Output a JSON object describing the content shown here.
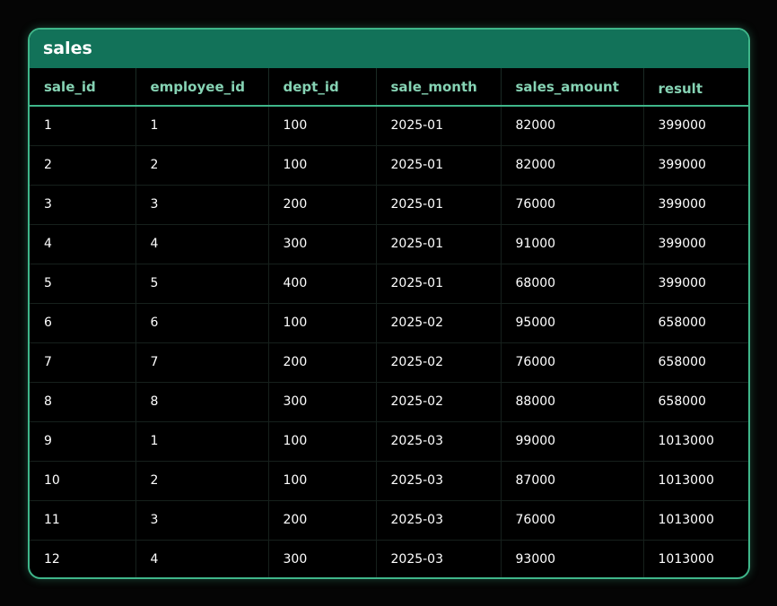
{
  "table": {
    "title": "sales",
    "columns": [
      "sale_id",
      "employee_id",
      "dept_id",
      "sale_month",
      "sales_amount",
      "result"
    ],
    "rows": [
      [
        "1",
        "1",
        "100",
        "2025-01",
        "82000",
        "399000"
      ],
      [
        "2",
        "2",
        "100",
        "2025-01",
        "82000",
        "399000"
      ],
      [
        "3",
        "3",
        "200",
        "2025-01",
        "76000",
        "399000"
      ],
      [
        "4",
        "4",
        "300",
        "2025-01",
        "91000",
        "399000"
      ],
      [
        "5",
        "5",
        "400",
        "2025-01",
        "68000",
        "399000"
      ],
      [
        "6",
        "6",
        "100",
        "2025-02",
        "95000",
        "658000"
      ],
      [
        "7",
        "7",
        "200",
        "2025-02",
        "76000",
        "658000"
      ],
      [
        "8",
        "8",
        "300",
        "2025-02",
        "88000",
        "658000"
      ],
      [
        "9",
        "1",
        "100",
        "2025-03",
        "99000",
        "1013000"
      ],
      [
        "10",
        "2",
        "100",
        "2025-03",
        "87000",
        "1013000"
      ],
      [
        "11",
        "3",
        "200",
        "2025-03",
        "76000",
        "1013000"
      ],
      [
        "12",
        "4",
        "300",
        "2025-03",
        "93000",
        "1013000"
      ]
    ]
  },
  "colors": {
    "accent_border": "#3fb68a",
    "title_bar": "#127259",
    "header_text": "#86d3b4",
    "background": "#000000"
  }
}
